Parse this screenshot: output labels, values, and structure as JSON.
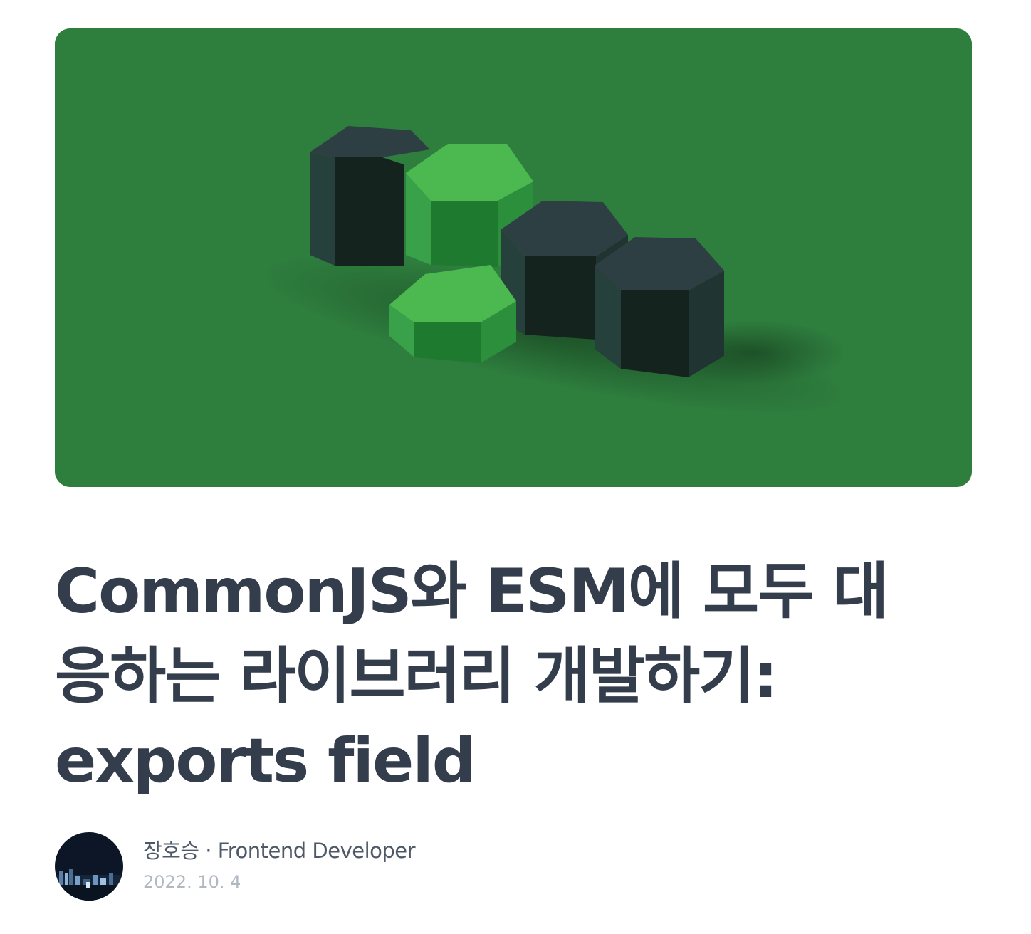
{
  "article": {
    "title": "CommonJS와 ESM에 모두 대응하는 라이브러리 개발하기: exports field",
    "author_name": "장호승",
    "separator": "·",
    "author_role": "Frontend Developer",
    "date": "2022. 10. 4"
  },
  "hero": {
    "background_color": "#2e7e3e",
    "subject": "green-and-dark-hexagon-blocks"
  },
  "colors": {
    "title": "#333d4b",
    "meta_text": "#4e5968",
    "date_text": "#b0b8c1"
  }
}
